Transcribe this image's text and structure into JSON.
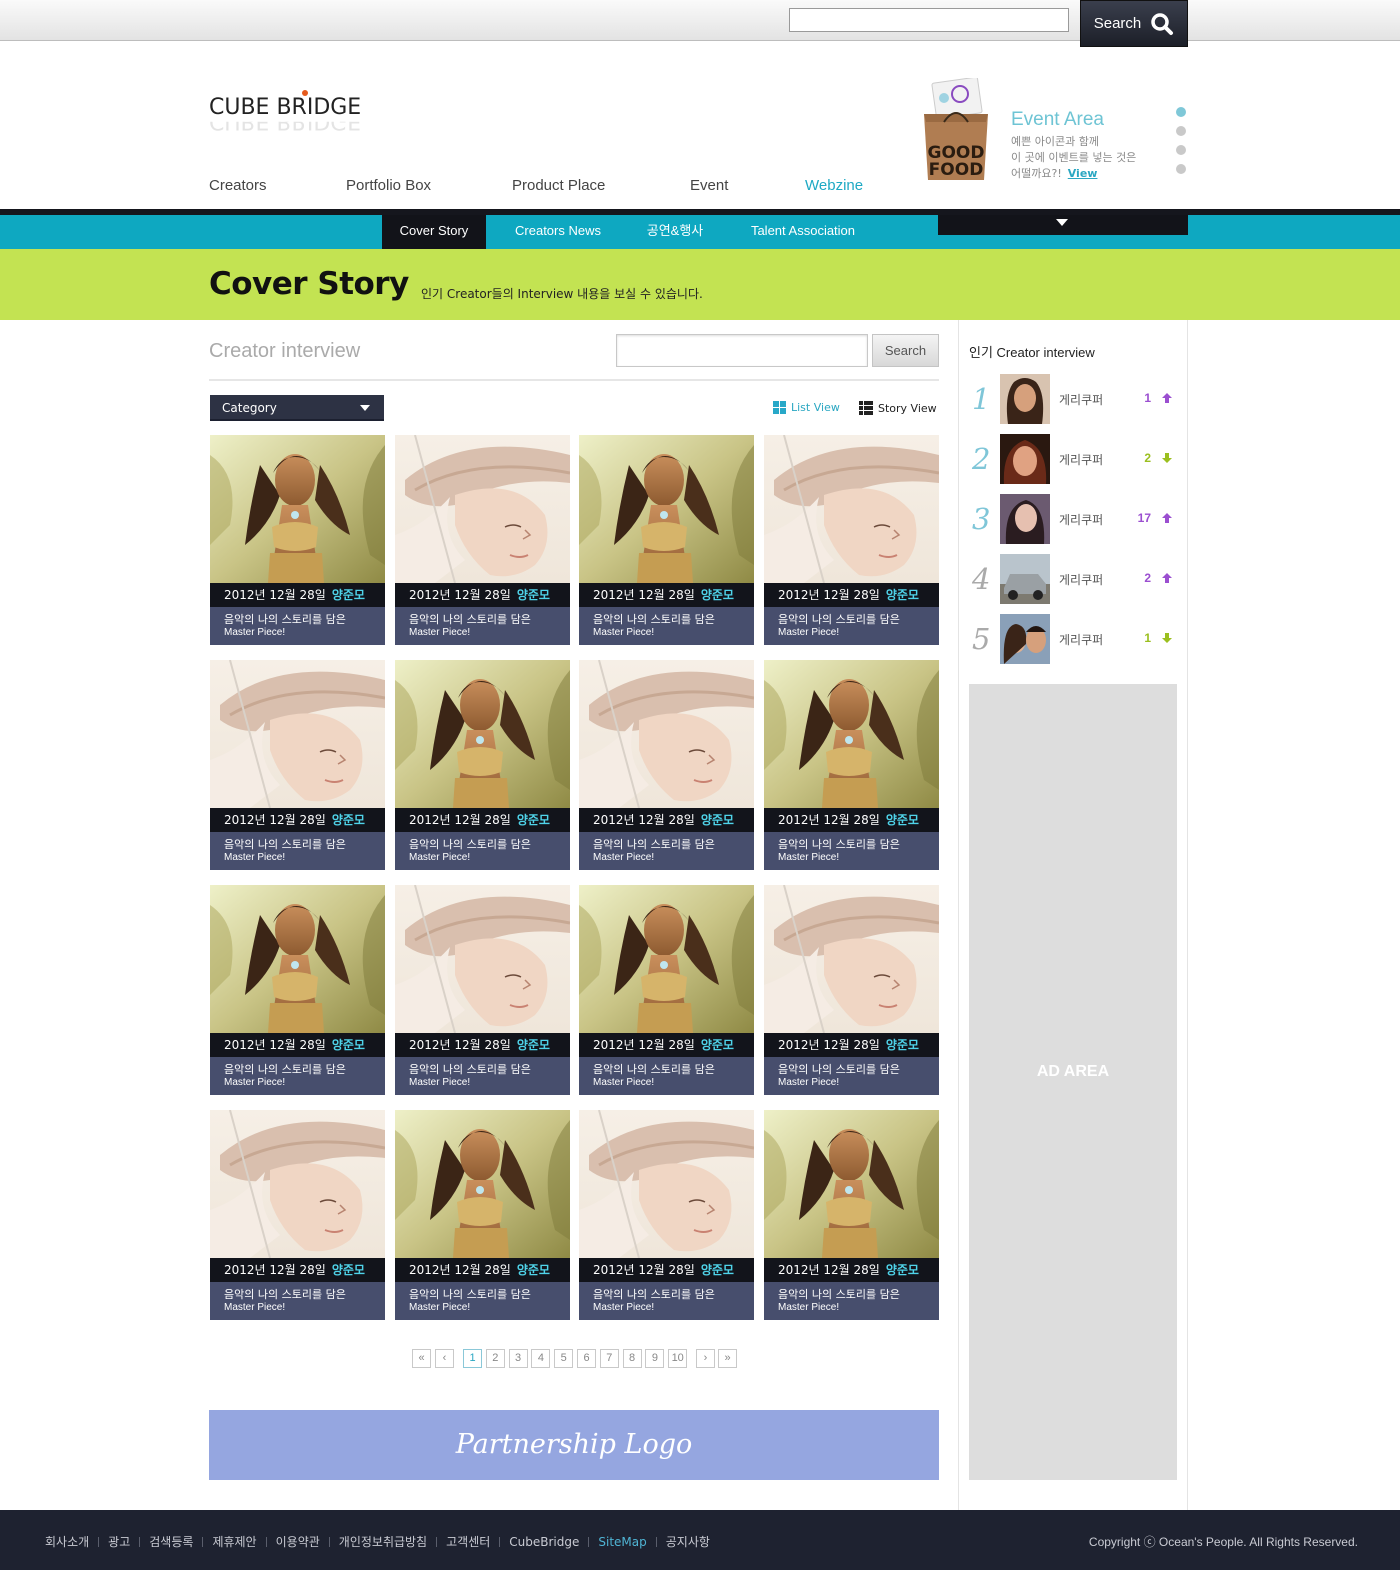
{
  "header": {
    "search_placeholder": "",
    "search_label": "Search",
    "logo_text": "CUBE BRIDGE",
    "nav": [
      "Creators",
      "Portfolio Box",
      "Product Place",
      "Event",
      "Webzine"
    ],
    "active_nav": "Webzine"
  },
  "event": {
    "bag_line1": "GOOD",
    "bag_line2": "FOOD",
    "title": "Event Area",
    "desc_lines": [
      "예쁜 아이콘과 함께",
      "이 곳에 이벤트를 넣는 것은",
      "어떨까요?!"
    ],
    "view_label": "View",
    "slides_total": 4,
    "slide_active": 1
  },
  "subnav": {
    "tabs": [
      "Cover Story",
      "Creators News",
      "공연&행사",
      "Talent Association"
    ],
    "active": "Cover Story"
  },
  "banner": {
    "title": "Cover Story",
    "subtitle": "인기 Creator들의 Interview 내용을 보실 수 있습니다."
  },
  "content": {
    "title": "Creator interview",
    "search_placeholder": "",
    "search_label": "Search",
    "category_label": "Category",
    "list_view_label": "List View",
    "story_view_label": "Story View"
  },
  "cards": [
    {
      "image": "warrior",
      "date": "2012년 12월 28일",
      "author": "양준모",
      "line1": "음악의 나의 스토리를 담은",
      "line2": "Master Piece!"
    },
    {
      "image": "lady",
      "date": "2012년 12월 28일",
      "author": "양준모",
      "line1": "음악의 나의 스토리를 담은",
      "line2": "Master Piece!"
    },
    {
      "image": "warrior",
      "date": "2012년 12월 28일",
      "author": "양준모",
      "line1": "음악의 나의 스토리를 담은",
      "line2": "Master Piece!"
    },
    {
      "image": "lady",
      "date": "2012년 12월 28일",
      "author": "양준모",
      "line1": "음악의 나의 스토리를 담은",
      "line2": "Master Piece!"
    },
    {
      "image": "lady",
      "date": "2012년 12월 28일",
      "author": "양준모",
      "line1": "음악의 나의 스토리를 담은",
      "line2": "Master Piece!"
    },
    {
      "image": "warrior",
      "date": "2012년 12월 28일",
      "author": "양준모",
      "line1": "음악의 나의 스토리를 담은",
      "line2": "Master Piece!"
    },
    {
      "image": "lady",
      "date": "2012년 12월 28일",
      "author": "양준모",
      "line1": "음악의 나의 스토리를 담은",
      "line2": "Master Piece!"
    },
    {
      "image": "warrior",
      "date": "2012년 12월 28일",
      "author": "양준모",
      "line1": "음악의 나의 스토리를 담은",
      "line2": "Master Piece!"
    },
    {
      "image": "warrior",
      "date": "2012년 12월 28일",
      "author": "양준모",
      "line1": "음악의 나의 스토리를 담은",
      "line2": "Master Piece!"
    },
    {
      "image": "lady",
      "date": "2012년 12월 28일",
      "author": "양준모",
      "line1": "음악의 나의 스토리를 담은",
      "line2": "Master Piece!"
    },
    {
      "image": "warrior",
      "date": "2012년 12월 28일",
      "author": "양준모",
      "line1": "음악의 나의 스토리를 담은",
      "line2": "Master Piece!"
    },
    {
      "image": "lady",
      "date": "2012년 12월 28일",
      "author": "양준모",
      "line1": "음악의 나의 스토리를 담은",
      "line2": "Master Piece!"
    },
    {
      "image": "lady",
      "date": "2012년 12월 28일",
      "author": "양준모",
      "line1": "음악의 나의 스토리를 담은",
      "line2": "Master Piece!"
    },
    {
      "image": "warrior",
      "date": "2012년 12월 28일",
      "author": "양준모",
      "line1": "음악의 나의 스토리를 담은",
      "line2": "Master Piece!"
    },
    {
      "image": "lady",
      "date": "2012년 12월 28일",
      "author": "양준모",
      "line1": "음악의 나의 스토리를 담은",
      "line2": "Master Piece!"
    },
    {
      "image": "warrior",
      "date": "2012년 12월 28일",
      "author": "양준모",
      "line1": "음악의 나의 스토리를 담은",
      "line2": "Master Piece!"
    }
  ],
  "pagination": {
    "first_icon": "double-chevron-left-icon",
    "prev_icon": "chevron-left-icon",
    "pages": [
      "1",
      "2",
      "3",
      "4",
      "5",
      "6",
      "7",
      "8",
      "9",
      "10"
    ],
    "current": "1",
    "next_icon": "chevron-right-icon",
    "last_icon": "double-chevron-right-icon"
  },
  "partnership": {
    "label": "Partnership Logo"
  },
  "sidebar": {
    "title": "인기 Creator interview",
    "ranking": [
      {
        "rank": "1",
        "name": "게리쿠퍼",
        "count": "1",
        "trend": "up",
        "color": "#9b4fd0",
        "avatar": "woman-dark"
      },
      {
        "rank": "2",
        "name": "게리쿠퍼",
        "count": "2",
        "trend": "down",
        "color": "#9bbf1f",
        "avatar": "woman-red"
      },
      {
        "rank": "3",
        "name": "게리쿠퍼",
        "count": "17",
        "trend": "up",
        "color": "#9b4fd0",
        "avatar": "woman-selfie"
      },
      {
        "rank": "4",
        "name": "게리쿠퍼",
        "count": "2",
        "trend": "up",
        "color": "#9b4fd0",
        "avatar": "car"
      },
      {
        "rank": "5",
        "name": "게리쿠퍼",
        "count": "1",
        "trend": "down",
        "color": "#9bbf1f",
        "avatar": "couple"
      }
    ],
    "ad_label": "AD AREA"
  },
  "footer": {
    "links": [
      "회사소개",
      "광고",
      "검색등록",
      "제휴제안",
      "이용약관",
      "개인정보취급방침",
      "고객센터",
      "CubeBridge",
      "SiteMap",
      "공지사항"
    ],
    "highlight": "SiteMap",
    "copyright": "Copyright ⓒ Ocean's People. All Rights Reserved."
  },
  "colors": {
    "accent": "#0ea8c1",
    "banner": "#c3e352",
    "dark": "#15161d",
    "card_meta": "#474e6d",
    "footer": "#1e2230"
  }
}
